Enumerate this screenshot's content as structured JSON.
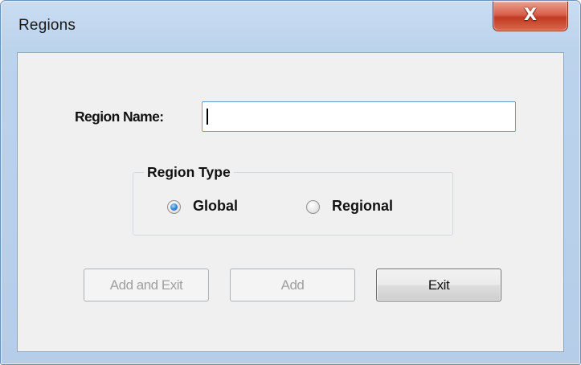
{
  "window": {
    "title": "Regions",
    "close_label": "X"
  },
  "form": {
    "region_name_label": "Region Name:",
    "region_name_value": "",
    "region_type": {
      "legend": "Region Type",
      "options": [
        {
          "label": "Global",
          "selected": true
        },
        {
          "label": "Regional",
          "selected": false
        }
      ]
    }
  },
  "buttons": {
    "add_and_exit": {
      "label": "Add and Exit",
      "enabled": false
    },
    "add": {
      "label": "Add",
      "enabled": false
    },
    "exit": {
      "label": "Exit",
      "enabled": true
    }
  },
  "colors": {
    "window_frame": "#b5cde8",
    "client_bg": "#f0f0f0",
    "close_button": "#c23a22",
    "radio_selected": "#3b8ee0",
    "input_border": "#7aa0c8"
  }
}
